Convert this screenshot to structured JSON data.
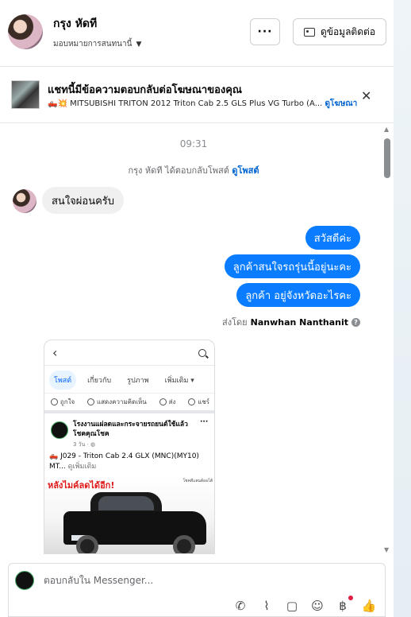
{
  "header": {
    "name": "กรุง หัดที",
    "assign_label": "มอบหมายการสนทนานี้",
    "more_button": "···",
    "contact_button": "ดูข้อมูลติดต่อ"
  },
  "ad_banner": {
    "title": "แชทนี้มีข้อความตอบกลับต่อโฆษณาของคุณ",
    "subtitle": "🛻💥 MITSUBISHI TRITON 2012 Triton Cab 2.5 GLS Plus VG Turbo (A...",
    "link": "ดูโฆษณา"
  },
  "chat": {
    "timestamp": "09:31",
    "reply_note_prefix": "กรุง หัดที ได้ตอบกลับโพสต์",
    "reply_note_link": "ดูโพสต์",
    "incoming": [
      "สนใจผ่อนครับ"
    ],
    "outgoing": [
      "สวัสดีค่ะ",
      "ลูกค้าสนใจรถรุ่นนี้อยู่นะคะ",
      "ลูกค้า อยู่จังหวัดอะไรคะ"
    ],
    "sent_by_label": "ส่งโดย",
    "sent_by_name": "Nanwhan Nanthanit"
  },
  "shared_post": {
    "tabs": [
      "โพสต์",
      "เกี่ยวกับ",
      "รูปภาพ",
      "เพิ่มเติม ▾"
    ],
    "actions": [
      "ถูกใจ",
      "แสดงความคิดเห็น",
      "ส่ง",
      "แชร์"
    ],
    "page_name": "โรงงานแผ่ลดและกระจายรถยนต์ใช้แล้ว โชคคุณโชค",
    "post_time": "3 วัน · ◍",
    "more": "···",
    "post_text": "🛻 J029 - Triton Cab 2.4 GLX (MNC)(MY10) MT...",
    "see_more": "ดูเพิ่มเติม",
    "photo_text": "หลังไมค์ลดได้อีก!",
    "photo_tag": "โชคดีแลนด์ออโต้"
  },
  "composer": {
    "placeholder": "ตอบกลับใน Messenger..."
  },
  "icons": [
    "avatar",
    "dots-icon",
    "contact-card-icon",
    "chevron-down-icon",
    "close-icon",
    "phone-icon",
    "paperclip-icon",
    "saved-reply-icon",
    "emoji-icon",
    "payment-icon",
    "like-icon"
  ],
  "colors": {
    "accent": "#0a7cff",
    "link": "#0064d1"
  }
}
